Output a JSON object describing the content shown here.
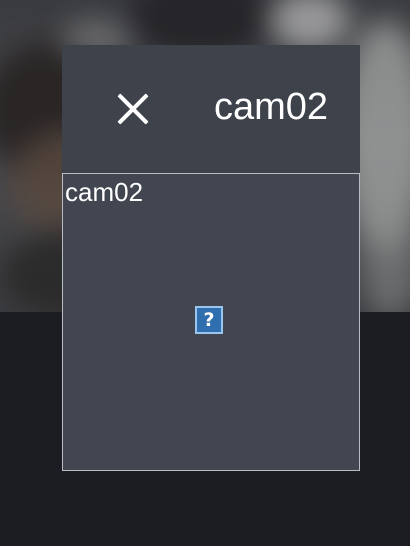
{
  "dialog": {
    "title": "cam02",
    "close_icon": "close-icon"
  },
  "preview": {
    "label": "cam02",
    "image_state": "broken-image-icon",
    "image_glyph": "?"
  },
  "colors": {
    "dialog_bg": "#3e424b",
    "preview_border": "#b9bcc3",
    "broken_icon_bg": "#2f6fb0",
    "page_bg": "#1c1d22"
  }
}
